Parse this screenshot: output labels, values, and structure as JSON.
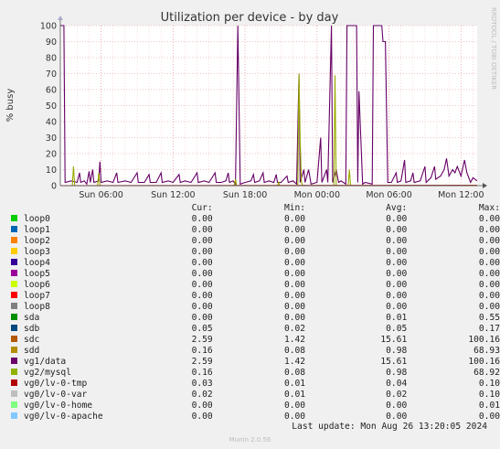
{
  "chart_data": {
    "type": "line",
    "title": "Utilization per device - by day",
    "ylabel": "% busy",
    "xlabel": "",
    "ylim": [
      0,
      100
    ],
    "yticks": [
      0,
      10,
      20,
      30,
      40,
      50,
      60,
      70,
      80,
      90,
      100
    ],
    "grid": true,
    "x_range_hours": [
      3.0,
      13.35
    ],
    "xticks": [
      {
        "label": "Sun 06:00",
        "hour": 6
      },
      {
        "label": "Sun 12:00",
        "hour": 12
      },
      {
        "label": "Sun 18:00",
        "hour": 18
      },
      {
        "label": "Mon 00:00",
        "hour": 24
      },
      {
        "label": "Mon 06:00",
        "hour": 30
      },
      {
        "label": "Mon 12:00",
        "hour": 36
      }
    ],
    "series": [
      {
        "name": "vg1/data",
        "color": "#660066",
        "points": [
          [
            2.0,
            1
          ],
          [
            2.1,
            100
          ],
          [
            2.9,
            100
          ],
          [
            3.0,
            2
          ],
          [
            3.5,
            3
          ],
          [
            4.0,
            2
          ],
          [
            4.2,
            8
          ],
          [
            4.3,
            2
          ],
          [
            4.6,
            3
          ],
          [
            4.8,
            1
          ],
          [
            5.0,
            9
          ],
          [
            5.1,
            2
          ],
          [
            5.3,
            10
          ],
          [
            5.4,
            2
          ],
          [
            5.8,
            3
          ],
          [
            5.9,
            15
          ],
          [
            6.0,
            2
          ],
          [
            6.5,
            3
          ],
          [
            7.0,
            2
          ],
          [
            7.3,
            8
          ],
          [
            7.4,
            2
          ],
          [
            8.0,
            3
          ],
          [
            8.5,
            2
          ],
          [
            9.0,
            8
          ],
          [
            9.1,
            2
          ],
          [
            9.6,
            2
          ],
          [
            10.0,
            7
          ],
          [
            10.1,
            2
          ],
          [
            10.6,
            2
          ],
          [
            11.0,
            8
          ],
          [
            11.1,
            2
          ],
          [
            11.6,
            3
          ],
          [
            12.0,
            2
          ],
          [
            12.5,
            7
          ],
          [
            12.6,
            2
          ],
          [
            13.0,
            3
          ],
          [
            13.5,
            2
          ],
          [
            14.0,
            8
          ],
          [
            14.1,
            2
          ],
          [
            14.6,
            3
          ],
          [
            15.0,
            2
          ],
          [
            15.5,
            8
          ],
          [
            15.6,
            2
          ],
          [
            16.0,
            2
          ],
          [
            16.4,
            3
          ],
          [
            16.6,
            8
          ],
          [
            16.7,
            2
          ],
          [
            17.0,
            3
          ],
          [
            17.2,
            1
          ],
          [
            17.4,
            100
          ],
          [
            17.6,
            1
          ],
          [
            18.0,
            2
          ],
          [
            18.5,
            3
          ],
          [
            18.7,
            7
          ],
          [
            18.8,
            2
          ],
          [
            19.2,
            3
          ],
          [
            19.5,
            8
          ],
          [
            19.6,
            2
          ],
          [
            20.0,
            3
          ],
          [
            20.4,
            2
          ],
          [
            20.6,
            7
          ],
          [
            20.7,
            2
          ],
          [
            21.0,
            2
          ],
          [
            21.5,
            6
          ],
          [
            21.6,
            2
          ],
          [
            22.0,
            3
          ],
          [
            22.3,
            1
          ],
          [
            22.5,
            70
          ],
          [
            22.6,
            2
          ],
          [
            22.9,
            10
          ],
          [
            23.0,
            2
          ],
          [
            23.3,
            10
          ],
          [
            23.5,
            1
          ],
          [
            24.0,
            2
          ],
          [
            24.3,
            30
          ],
          [
            24.4,
            2
          ],
          [
            24.8,
            10
          ],
          [
            24.9,
            2
          ],
          [
            25.2,
            100
          ],
          [
            25.3,
            2
          ],
          [
            25.6,
            10
          ],
          [
            25.8,
            2
          ],
          [
            26.0,
            3
          ],
          [
            26.4,
            1
          ],
          [
            26.5,
            100
          ],
          [
            27.3,
            100
          ],
          [
            27.4,
            2
          ],
          [
            27.5,
            59
          ],
          [
            27.7,
            20
          ],
          [
            27.8,
            1
          ],
          [
            28.0,
            2
          ],
          [
            28.6,
            1
          ],
          [
            28.7,
            100
          ],
          [
            29.4,
            100
          ],
          [
            29.5,
            90
          ],
          [
            29.7,
            90
          ],
          [
            29.9,
            2
          ],
          [
            30.2,
            2
          ],
          [
            30.6,
            8
          ],
          [
            30.7,
            2
          ],
          [
            31.0,
            3
          ],
          [
            31.3,
            16
          ],
          [
            31.4,
            2
          ],
          [
            31.8,
            3
          ],
          [
            32.0,
            8
          ],
          [
            32.1,
            2
          ],
          [
            32.6,
            3
          ],
          [
            33.0,
            12
          ],
          [
            33.1,
            2
          ],
          [
            33.5,
            5
          ],
          [
            33.8,
            12
          ],
          [
            33.9,
            4
          ],
          [
            34.3,
            6
          ],
          [
            34.6,
            10
          ],
          [
            34.8,
            17
          ],
          [
            35.0,
            6
          ],
          [
            35.3,
            10
          ],
          [
            35.5,
            8
          ],
          [
            35.7,
            12
          ],
          [
            36.0,
            6
          ],
          [
            36.3,
            16
          ],
          [
            36.5,
            8
          ],
          [
            36.8,
            2
          ],
          [
            37.0,
            5
          ],
          [
            37.35,
            3
          ]
        ]
      },
      {
        "name": "vg2/mysql",
        "color": "#99AA00",
        "points": [
          [
            2.0,
            0
          ],
          [
            3.6,
            0
          ],
          [
            3.7,
            12
          ],
          [
            3.8,
            0
          ],
          [
            5.7,
            0
          ],
          [
            5.8,
            8
          ],
          [
            5.9,
            0
          ],
          [
            17.1,
            0
          ],
          [
            17.2,
            4
          ],
          [
            17.3,
            0
          ],
          [
            20.7,
            0
          ],
          [
            20.8,
            2
          ],
          [
            20.9,
            0
          ],
          [
            22.4,
            0
          ],
          [
            22.5,
            70
          ],
          [
            22.6,
            28
          ],
          [
            22.7,
            2
          ],
          [
            22.8,
            0
          ],
          [
            25.4,
            0
          ],
          [
            25.5,
            69
          ],
          [
            25.6,
            0
          ],
          [
            26.6,
            0
          ],
          [
            26.7,
            10
          ],
          [
            26.8,
            0
          ],
          [
            37.35,
            0
          ]
        ]
      },
      {
        "name": "vg0/lv-0-tmp",
        "color": "#AA3333",
        "points": [
          [
            2.0,
            0
          ],
          [
            37.35,
            0.3
          ]
        ]
      }
    ],
    "legend": {
      "columns": [
        "Cur:",
        "Min:",
        "Avg:",
        "Max:"
      ],
      "rows": [
        {
          "name": "loop0",
          "color": "#00CC00",
          "cur": "0.00",
          "min": "0.00",
          "avg": "0.00",
          "max": "0.00"
        },
        {
          "name": "loop1",
          "color": "#0066B3",
          "cur": "0.00",
          "min": "0.00",
          "avg": "0.00",
          "max": "0.00"
        },
        {
          "name": "loop2",
          "color": "#FF8000",
          "cur": "0.00",
          "min": "0.00",
          "avg": "0.00",
          "max": "0.00"
        },
        {
          "name": "loop3",
          "color": "#FFCC00",
          "cur": "0.00",
          "min": "0.00",
          "avg": "0.00",
          "max": "0.00"
        },
        {
          "name": "loop4",
          "color": "#330099",
          "cur": "0.00",
          "min": "0.00",
          "avg": "0.00",
          "max": "0.00"
        },
        {
          "name": "loop5",
          "color": "#990099",
          "cur": "0.00",
          "min": "0.00",
          "avg": "0.00",
          "max": "0.00"
        },
        {
          "name": "loop6",
          "color": "#CCFF00",
          "cur": "0.00",
          "min": "0.00",
          "avg": "0.00",
          "max": "0.00"
        },
        {
          "name": "loop7",
          "color": "#FF0000",
          "cur": "0.00",
          "min": "0.00",
          "avg": "0.00",
          "max": "0.00"
        },
        {
          "name": "loop8",
          "color": "#808080",
          "cur": "0.00",
          "min": "0.00",
          "avg": "0.00",
          "max": "0.00"
        },
        {
          "name": "sda",
          "color": "#008F00",
          "cur": "0.00",
          "min": "0.00",
          "avg": "0.01",
          "max": "0.55"
        },
        {
          "name": "sdb",
          "color": "#00487D",
          "cur": "0.05",
          "min": "0.02",
          "avg": "0.05",
          "max": "0.17"
        },
        {
          "name": "sdc",
          "color": "#B35A00",
          "cur": "2.59",
          "min": "1.42",
          "avg": "15.61",
          "max": "100.16"
        },
        {
          "name": "sdd",
          "color": "#B38F00",
          "cur": "0.16",
          "min": "0.08",
          "avg": "0.98",
          "max": "68.93"
        },
        {
          "name": "vg1/data",
          "color": "#6B006B",
          "cur": "2.59",
          "min": "1.42",
          "avg": "15.61",
          "max": "100.16"
        },
        {
          "name": "vg2/mysql",
          "color": "#8FB300",
          "cur": "0.16",
          "min": "0.08",
          "avg": "0.98",
          "max": "68.92"
        },
        {
          "name": "vg0/lv-0-tmp",
          "color": "#B30000",
          "cur": "0.03",
          "min": "0.01",
          "avg": "0.04",
          "max": "0.10"
        },
        {
          "name": "vg0/lv-0-var",
          "color": "#BEBEBE",
          "cur": "0.02",
          "min": "0.01",
          "avg": "0.02",
          "max": "0.10"
        },
        {
          "name": "vg0/lv-0-home",
          "color": "#80FF80",
          "cur": "0.00",
          "min": "0.00",
          "avg": "0.00",
          "max": "0.01"
        },
        {
          "name": "vg0/lv-0-apache",
          "color": "#80C9FF",
          "cur": "0.00",
          "min": "0.00",
          "avg": "0.00",
          "max": "0.00"
        }
      ]
    }
  },
  "watermark": "RRDTOOL / TOBI OETIKER",
  "last_update": "Last update: Mon Aug 26 13:20:05 2024",
  "footer": "Munin 2.0.56"
}
